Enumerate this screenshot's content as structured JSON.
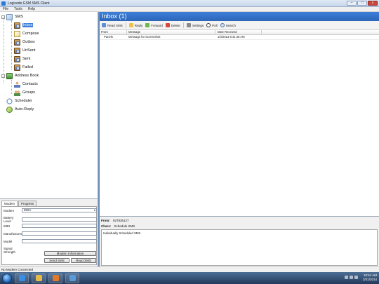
{
  "window": {
    "title": "Logicode GSM SMS Client",
    "controls": [
      "–",
      "□",
      "x"
    ]
  },
  "menu": [
    "File",
    "Tools",
    "Help"
  ],
  "tree": {
    "root_sms": "SMS",
    "sms_children": [
      "Inbox",
      "Compose",
      "Outbox",
      "UnSent",
      "Sent",
      "Failed"
    ],
    "address_book": "Address Book",
    "address_children": [
      "Contacts",
      "Groups"
    ],
    "scheduler": "Scheduler",
    "auto_reply": "Auto-Reply",
    "selected": "Inbox"
  },
  "modem_panel": {
    "tabs": [
      "Modem",
      "Progress"
    ],
    "modem_label": "Modem",
    "modem_value": "MOA",
    "fields": [
      {
        "label": "Battery Level",
        "value": ""
      },
      {
        "label": "IMEI",
        "value": ""
      },
      {
        "label": "Manufacturer",
        "value": ""
      },
      {
        "label": "Model",
        "value": ""
      },
      {
        "label": "Signal Strength",
        "value": ""
      }
    ],
    "buttons": {
      "modem_info": "Modem Information",
      "send_sms": "Send SMS",
      "read_sms": "Read SMS"
    }
  },
  "inbox": {
    "header": "Inbox (1)",
    "toolbar": [
      "Read SMS",
      "Reply",
      "Forward",
      "Delete",
      "Settings",
      "Poll",
      "Search"
    ],
    "columns": [
      "From",
      "Message",
      "Date Received"
    ],
    "rows": [
      {
        "from": "Panels",
        "message": "Message for Screenshot",
        "date": "1/3/2013 6:41:46 AM"
      }
    ]
  },
  "detail": {
    "from_label": "From:",
    "from_value": "927836127",
    "chars_label": "Chars:",
    "chars_value": "Schedule SMS",
    "body": "Individually Scheduled SMS"
  },
  "statusbar": {
    "text": "No Modem Connected"
  },
  "taskbar": {
    "time": "10:51 AM",
    "date": "3/31/2014"
  },
  "colors": {
    "accent": "#3d7fd9",
    "taskbar": "#23395a"
  }
}
